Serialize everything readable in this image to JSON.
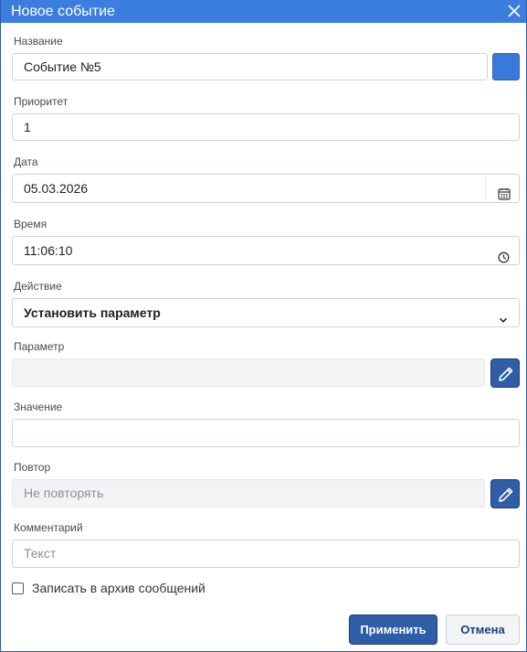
{
  "dialog": {
    "title": "Новое событие"
  },
  "fields": {
    "name": {
      "label": "Название",
      "value": "Событие №5"
    },
    "priority": {
      "label": "Приоритет",
      "value": "1"
    },
    "date": {
      "label": "Дата",
      "value": "05.03.2026"
    },
    "time": {
      "label": "Время",
      "value": "11:06:10"
    },
    "action": {
      "label": "Действие",
      "value": "Установить параметр"
    },
    "parameter": {
      "label": "Параметр",
      "value": ""
    },
    "value": {
      "label": "Значение",
      "value": ""
    },
    "repeat": {
      "label": "Повтор",
      "value": "Не повторять"
    },
    "comment": {
      "label": "Комментарий",
      "placeholder": "Текст"
    }
  },
  "archive_checkbox": {
    "label": "Записать в архив сообщений",
    "checked": false
  },
  "buttons": {
    "apply": "Применить",
    "cancel": "Отмена"
  },
  "colors": {
    "titlebar": "#3c7ee0",
    "accent": "#2f5da8",
    "swatch": "#3a78da"
  },
  "icons": {
    "close": "close-icon",
    "calendar": "calendar-icon",
    "clock": "clock-icon",
    "dropdown": "chevron-down-icon",
    "edit": "pencil-icon"
  }
}
